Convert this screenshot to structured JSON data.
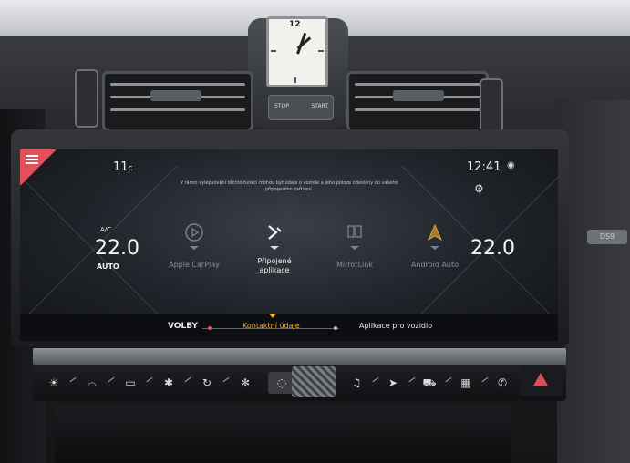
{
  "clock": {
    "twelve": "12",
    "stop_label": "STOP",
    "start_label": "START"
  },
  "screen": {
    "outside_temp": "11",
    "temp_unit": "c",
    "time": "12:41",
    "notice_line1": "V rámci vylepšování těchto funkcí mohou být údaje o vozidle a jeho poloze odeslány do vašeho",
    "notice_line2": "připojeného zařízení.",
    "left_climate": {
      "ac": "A/C",
      "temp": "22.0",
      "mode": "AUTO"
    },
    "right_climate": {
      "temp": "22.0"
    },
    "apps": [
      {
        "label": "Apple CarPlay",
        "icon": "play-circle-icon"
      },
      {
        "label": "Připojené\naplikace",
        "icon": "connected-apps-icon"
      },
      {
        "label": "MirrorLink",
        "icon": "mirrorlink-icon"
      },
      {
        "label": "Android Auto",
        "icon": "android-auto-icon"
      }
    ],
    "tabs": {
      "volby": "VOLBY",
      "kontaktni": "Kontaktní údaje",
      "aplikace": "Aplikace pro vozidlo"
    },
    "accent": "#e4505a",
    "highlight": "#f0b12b"
  },
  "controls": [
    "sun-icon",
    "defrost-front-icon",
    "defrost-rear-icon",
    "fan-off-icon",
    "recirculation-icon",
    "fan-icon",
    "music-icon",
    "navigation-icon",
    "car-icon",
    "grid-icon",
    "phone-icon",
    "hazard-icon"
  ],
  "badge": "DS9"
}
